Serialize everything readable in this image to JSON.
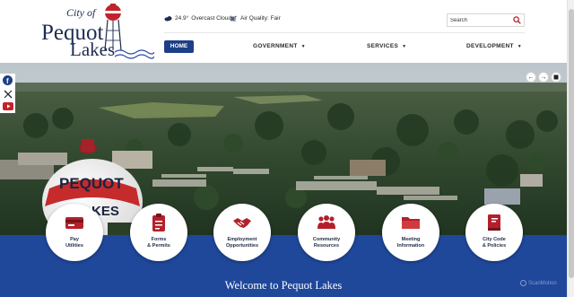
{
  "logo": {
    "line1": "City of",
    "line2": "Pequot",
    "line3": "Lakes"
  },
  "weather": {
    "temp": "24.9°",
    "condition": "Overcast Clouds",
    "icon": "cloud-icon"
  },
  "air_quality": {
    "text": "Air Quality: Fair",
    "icon": "air-quality-icon"
  },
  "search": {
    "placeholder": "Search"
  },
  "nav": [
    {
      "label": "HOME",
      "active": true
    },
    {
      "label": "GOVERNMENT",
      "dropdown": true
    },
    {
      "label": "SERVICES",
      "dropdown": true
    },
    {
      "label": "DEVELOPMENT",
      "dropdown": true
    }
  ],
  "social": [
    "facebook-icon",
    "x-icon",
    "youtube-icon"
  ],
  "slideshow": {
    "controls": [
      "previous-icon",
      "next-icon",
      "pause-icon"
    ]
  },
  "hero_sign": "PEQUOT LAKES",
  "quick_links": [
    {
      "label": "Pay\nUtilities",
      "icon": "credit-card-icon"
    },
    {
      "label": "Forms\n& Permits",
      "icon": "clipboard-icon"
    },
    {
      "label": "Employment\nOpportunities",
      "icon": "handshake-icon"
    },
    {
      "label": "Community\nResources",
      "icon": "people-icon"
    },
    {
      "label": "Meeting\nInformation",
      "icon": "folder-icon"
    },
    {
      "label": "City Code\n& Policies",
      "icon": "book-icon"
    }
  ],
  "welcome": "Welcome to Pequot Lakes",
  "watermark": "ScanMotion",
  "colors": {
    "brand_blue": "#1f479a",
    "nav_active": "#1c3f87",
    "icon_red": "#b3202b"
  }
}
